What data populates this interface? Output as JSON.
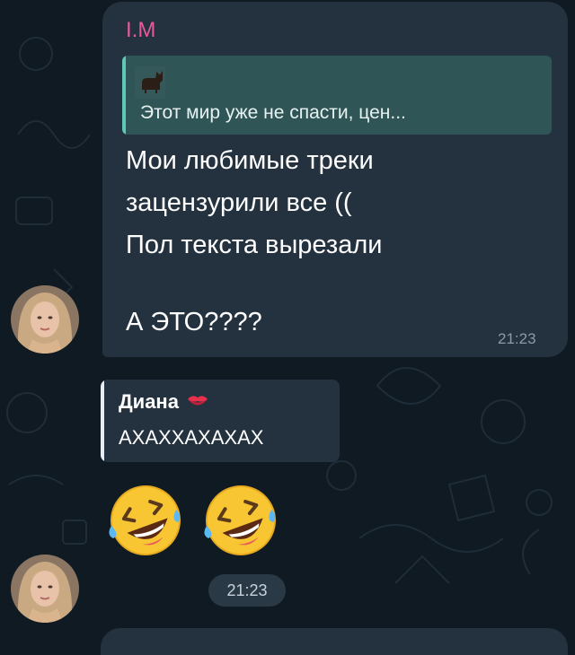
{
  "message1": {
    "sender": "I.M",
    "reply": {
      "text": "Этот мир уже не спасти, цен..."
    },
    "lines": [
      "Мои любимые треки",
      "зацензурили все ((",
      "Пол текста вырезали",
      "А ЭТО????"
    ],
    "time": "21:23"
  },
  "message2": {
    "quote": {
      "name": "Диана",
      "text": "АХАХХАХАХАХ"
    },
    "emojis": [
      "rofl-emoji",
      "rofl-emoji"
    ],
    "time": "21:23"
  },
  "colors": {
    "background": "#0f1a23",
    "bubble": "#24323f",
    "sender_name": "#e75a9a",
    "reply_bg": "#2f5556",
    "reply_bar": "#5fc7b6"
  }
}
